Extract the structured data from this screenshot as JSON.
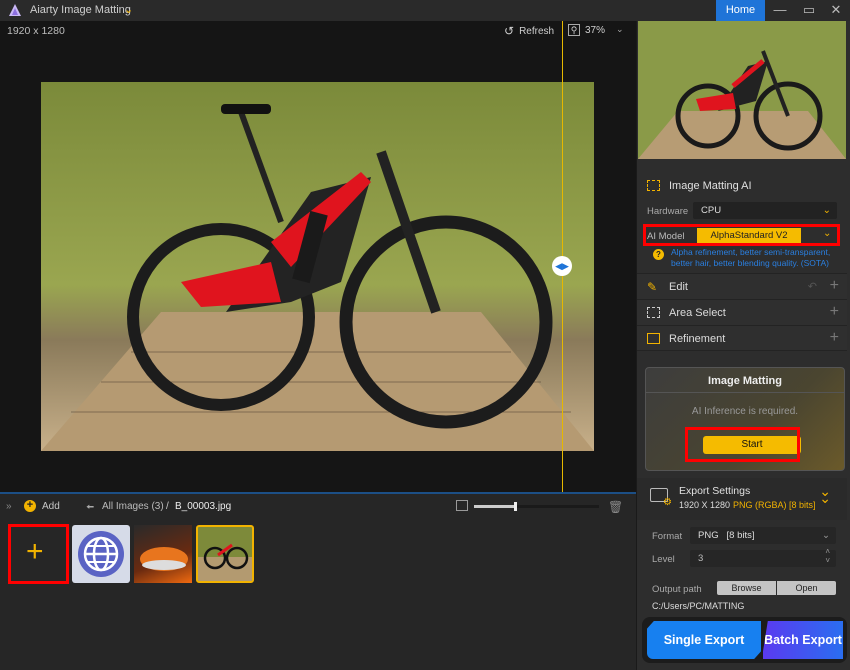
{
  "app": {
    "title": "Aiarty Image Matting",
    "home_label": "Home"
  },
  "canvas": {
    "dimensions": "1920 x 1280",
    "refresh_label": "Refresh",
    "zoom_level": "37%",
    "split_position": 0.94
  },
  "bottom": {
    "add_label": "Add",
    "breadcrumb_root": "All Images (3)",
    "breadcrumb_sep": "/",
    "breadcrumb_file": "B_00003.jpg",
    "thumb_size_slider": 0.32,
    "thumbnails": [
      {
        "name": "add-new",
        "type": "add"
      },
      {
        "name": "globe",
        "type": "icon"
      },
      {
        "name": "sneaker",
        "type": "image"
      },
      {
        "name": "bike",
        "type": "image",
        "selected": true
      }
    ]
  },
  "panel": {
    "matting_ai_title": "Image Matting AI",
    "hardware_label": "Hardware",
    "hardware_value": "CPU",
    "ai_model_label": "AI Model",
    "ai_model_value": "AlphaStandard  V2",
    "ai_model_desc": "Alpha refinement, better semi-transparent, better hair, better blending quality. (SOTA)",
    "sections": [
      {
        "label": "Edit"
      },
      {
        "label": "Area Select"
      },
      {
        "label": "Refinement"
      }
    ],
    "matting_card": {
      "title": "Image Matting",
      "message": "AI Inference is required.",
      "start_label": "Start"
    },
    "export": {
      "title": "Export Settings",
      "resolution": "1920 X 1280",
      "format_summary": "PNG (RGBA) [8 bits]",
      "format_label": "Format",
      "format_value": "PNG   [8 bits]",
      "level_label": "Level",
      "level_value": "3",
      "output_label": "Output path",
      "browse_label": "Browse",
      "open_label": "Open",
      "output_path": "C:/Users/PC/MATTING",
      "single_label": "Single Export",
      "batch_label": "Batch Export"
    }
  },
  "colors": {
    "accent": "#f5bb00",
    "brand_blue": "#1f74d8",
    "highlight_red": "#ff0000"
  }
}
